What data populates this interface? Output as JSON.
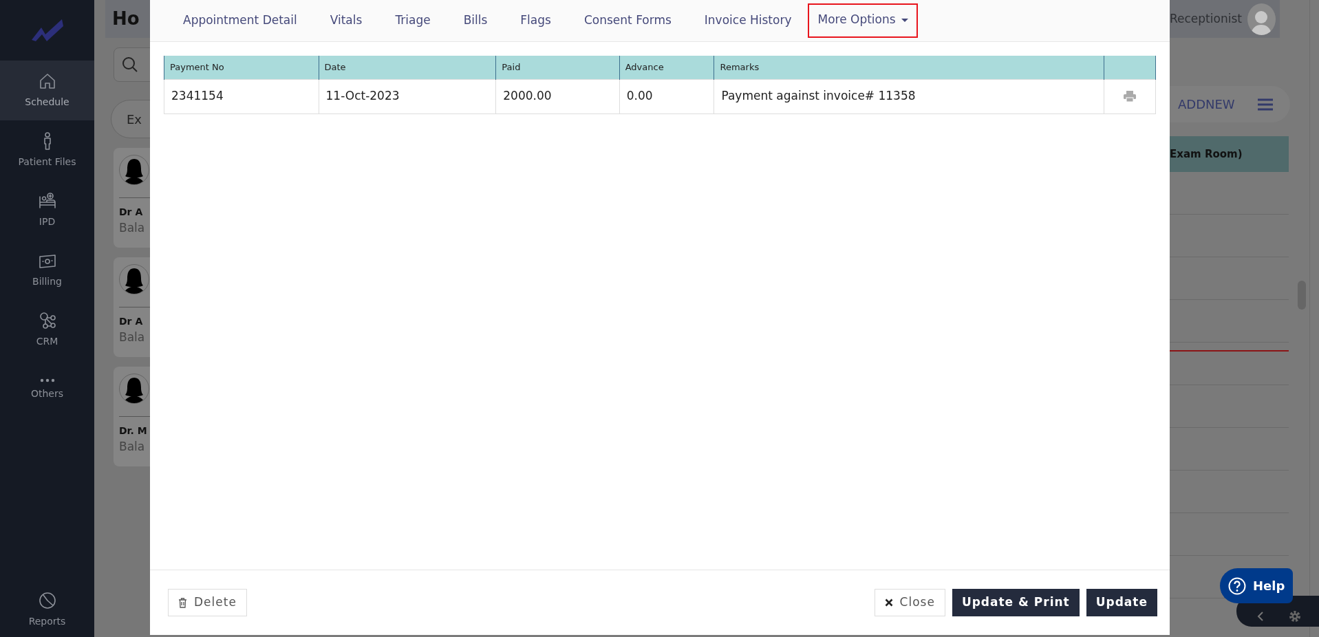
{
  "sidebar": {
    "items": [
      {
        "label": "Schedule",
        "selected": true
      },
      {
        "label": "Patient Files",
        "selected": false
      },
      {
        "label": "IPD",
        "selected": false
      },
      {
        "label": "Billing",
        "selected": false
      },
      {
        "label": "CRM",
        "selected": false
      },
      {
        "label": "Others",
        "selected": false
      }
    ],
    "footer_item": {
      "label": "Reports",
      "selected": false
    }
  },
  "background": {
    "page_title": "Ho",
    "filter_chip": "Ex",
    "doctor_cards": [
      {
        "name": "Dr A",
        "subtitle": "Bala"
      },
      {
        "name": "Dr A",
        "subtitle": "Bala"
      },
      {
        "name": "Dr. M",
        "subtitle": "Bala"
      }
    ],
    "user_role": "Receptionist",
    "add_new": "ADDNEW",
    "column_header": "Exam Room)",
    "help": "Help"
  },
  "modal": {
    "tabs": [
      {
        "label": "Appointment Detail",
        "selected": false,
        "highlighted": false,
        "kind": "tab"
      },
      {
        "label": "Vitals",
        "selected": false,
        "highlighted": false,
        "kind": "tab"
      },
      {
        "label": "Triage",
        "selected": false,
        "highlighted": false,
        "kind": "tab"
      },
      {
        "label": "Bills",
        "selected": false,
        "highlighted": false,
        "kind": "tab"
      },
      {
        "label": "Flags",
        "selected": false,
        "highlighted": false,
        "kind": "tab"
      },
      {
        "label": "Consent Forms",
        "selected": false,
        "highlighted": false,
        "kind": "tab"
      },
      {
        "label": "Invoice History",
        "selected": false,
        "highlighted": false,
        "kind": "tab"
      },
      {
        "label": "More Options",
        "selected": false,
        "highlighted": true,
        "kind": "dropdown"
      }
    ],
    "table": {
      "columns": [
        "Payment No",
        "Date",
        "Paid",
        "Advance",
        "Remarks"
      ],
      "rows": [
        {
          "cells": [
            "2341154",
            "11-Oct-2023",
            "2000.00",
            "0.00",
            "Payment against invoice# 11358"
          ]
        }
      ]
    },
    "buttons": [
      {
        "label": "Delete",
        "kind": "delete"
      },
      {
        "label": "Close",
        "kind": "close"
      },
      {
        "label": "Update & Print",
        "kind": "primary"
      },
      {
        "label": "Update",
        "kind": "primary"
      }
    ]
  }
}
